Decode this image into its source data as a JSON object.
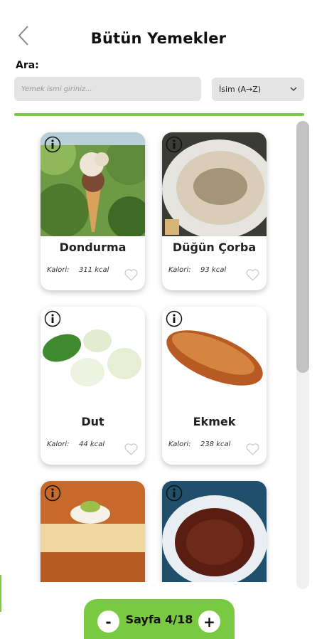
{
  "header": {
    "title": "Bütün Yemekler"
  },
  "search": {
    "label": "Ara:",
    "placeholder": "Yemek ismi giriniz..."
  },
  "sort": {
    "selected": "İsim (A→Z)"
  },
  "colors": {
    "accent": "#7ac943",
    "input_bg": "#e4e4e4",
    "scrollbar_thumb": "#c2c2c2"
  },
  "foods": [
    {
      "name": "Dondurma",
      "kalori_label": "Kalori:",
      "kalori_value": "311 kcal"
    },
    {
      "name": "Düğün Çorba",
      "kalori_label": "Kalori:",
      "kalori_value": "93 kcal"
    },
    {
      "name": "Dut",
      "kalori_label": "Kalori:",
      "kalori_value": "44 kcal"
    },
    {
      "name": "Ekmek",
      "kalori_label": "Kalori:",
      "kalori_value": "238 kcal"
    },
    {
      "name": "",
      "kalori_label": "",
      "kalori_value": ""
    },
    {
      "name": "",
      "kalori_label": "",
      "kalori_value": ""
    }
  ],
  "pager": {
    "minus": "-",
    "text": "Sayfa 4/18",
    "plus": "+"
  },
  "icons": {
    "back": "chevron-left-icon",
    "sort": "chevron-down-icon",
    "info": "info-icon",
    "favorite": "heart-outline-icon"
  }
}
